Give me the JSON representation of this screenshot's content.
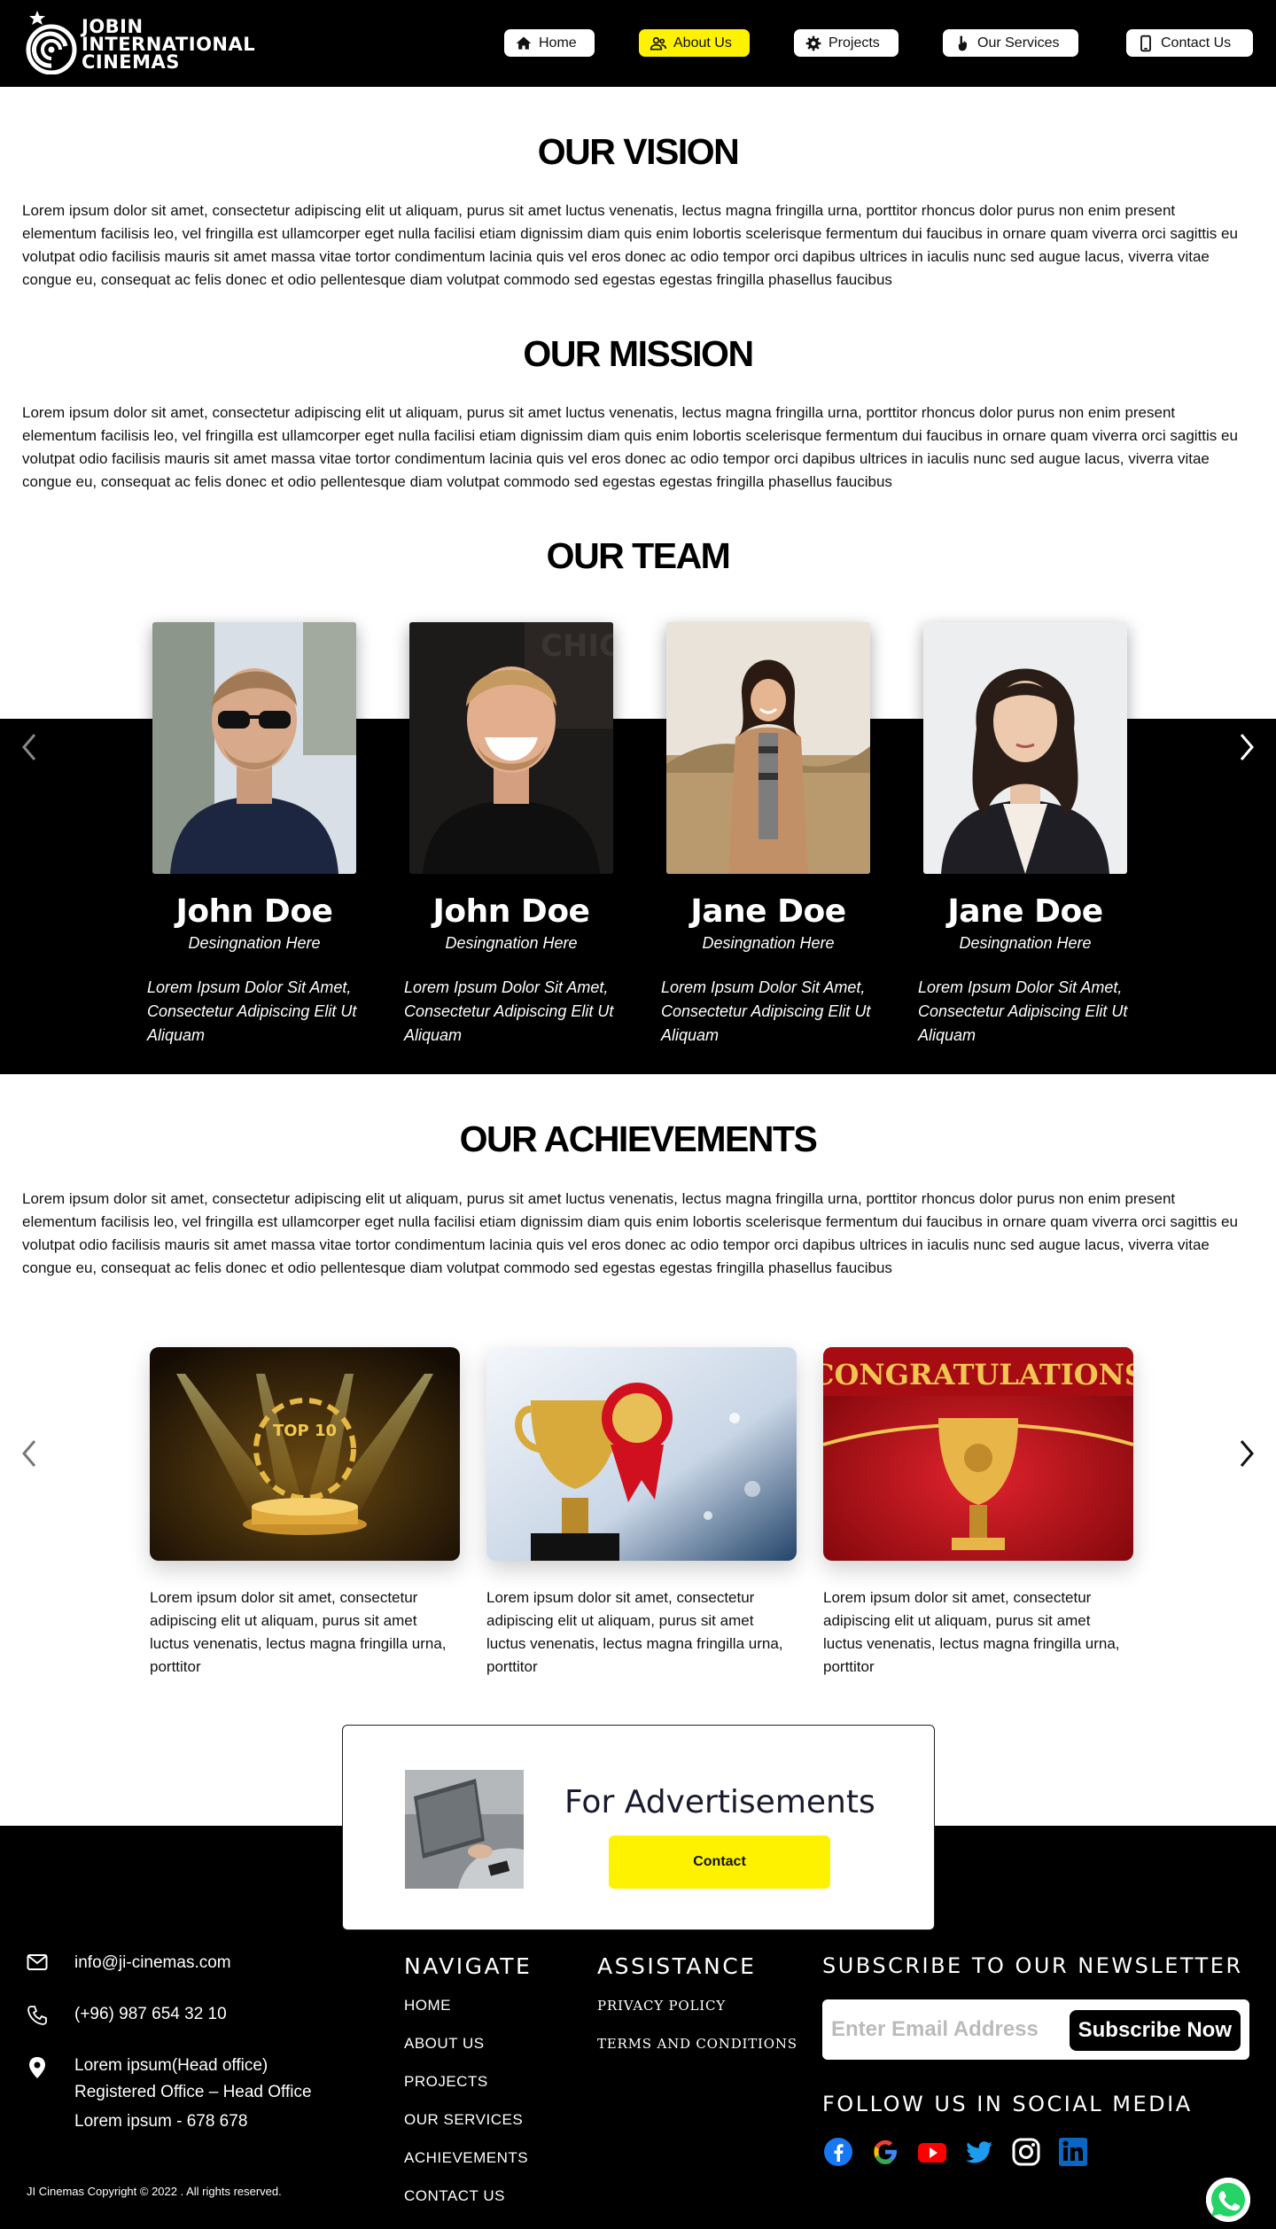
{
  "brand": {
    "line1": "JOBIN",
    "line2": "INTERNATIONAL",
    "line3": "CINEMAS"
  },
  "nav": [
    {
      "label": "Home",
      "icon": "home-icon"
    },
    {
      "label": "About Us",
      "icon": "users-icon",
      "active": true
    },
    {
      "label": "Projects",
      "icon": "gear-icon"
    },
    {
      "label": "Our Services",
      "icon": "hand-pointer-icon"
    },
    {
      "label": "Contact Us",
      "icon": "mobile-phone-icon"
    }
  ],
  "vision": {
    "title": "OUR VISION",
    "text": "Lorem ipsum dolor sit amet, consectetur adipiscing elit ut aliquam, purus sit amet luctus venenatis, lectus magna fringilla urna, porttitor rhoncus dolor purus non enim present elementum facilisis leo, vel fringilla est ullamcorper eget nulla facilisi etiam dignissim diam quis enim lobortis scelerisque fermentum dui faucibus in ornare quam viverra orci sagittis eu volutpat odio facilisis mauris sit amet massa vitae tortor condimentum lacinia quis vel eros donec ac odio tempor orci dapibus ultrices in iaculis nunc sed augue lacus, viverra vitae congue eu, consequat ac felis donec et odio pellentesque diam volutpat commodo sed egestas egestas fringilla phasellus faucibus"
  },
  "mission": {
    "title": "OUR MISSION",
    "text": "Lorem ipsum dolor sit amet, consectetur adipiscing elit ut aliquam, purus sit amet luctus venenatis, lectus magna fringilla urna, porttitor rhoncus dolor purus non enim present elementum facilisis leo, vel fringilla est ullamcorper eget nulla facilisi etiam dignissim diam quis enim lobortis scelerisque fermentum dui faucibus in ornare quam viverra orci sagittis eu volutpat odio facilisis mauris sit amet massa vitae tortor condimentum lacinia quis vel eros donec ac odio tempor orci dapibus ultrices in iaculis nunc sed augue lacus, viverra vitae congue eu, consequat ac felis donec et odio pellentesque diam volutpat commodo sed egestas egestas fringilla phasellus faucibus"
  },
  "team": {
    "title": "OUR TEAM",
    "members": [
      {
        "name": "John Doe",
        "role": "Desingnation Here",
        "bio": "Lorem Ipsum Dolor Sit Amet, Consectetur Adipiscing Elit Ut Aliquam"
      },
      {
        "name": "John Doe",
        "role": "Desingnation Here",
        "bio": "Lorem Ipsum Dolor Sit Amet, Consectetur Adipiscing Elit Ut Aliquam"
      },
      {
        "name": "Jane Doe",
        "role": "Desingnation Here",
        "bio": "Lorem Ipsum Dolor Sit Amet, Consectetur Adipiscing Elit Ut Aliquam"
      },
      {
        "name": "Jane Doe",
        "role": "Desingnation Here",
        "bio": "Lorem Ipsum Dolor Sit Amet, Consectetur Adipiscing Elit Ut Aliquam"
      }
    ]
  },
  "achievements": {
    "title": "OUR ACHIEVEMENTS",
    "text": "Lorem ipsum dolor sit amet, consectetur adipiscing elit ut aliquam, purus sit amet luctus venenatis, lectus magna fringilla urna, porttitor rhoncus dolor purus non enim present elementum facilisis leo, vel fringilla est ullamcorper eget nulla facilisi etiam dignissim diam quis enim lobortis scelerisque fermentum dui faucibus in ornare quam viverra orci sagittis eu volutpat odio facilisis mauris sit amet massa vitae tortor condimentum lacinia quis vel eros donec ac odio tempor orci dapibus ultrices in iaculis nunc sed augue lacus, viverra vitae congue eu, consequat ac felis donec et odio pellentesque diam volutpat commodo sed egestas egestas fringilla phasellus faucibus",
    "cards": [
      {
        "badge": "TOP 10",
        "text": "Lorem ipsum dolor sit amet, consectetur adipiscing elit ut aliquam, purus sit amet luctus venenatis, lectus magna fringilla urna, porttitor"
      },
      {
        "text": "Lorem ipsum dolor sit amet, consectetur adipiscing elit ut aliquam, purus sit amet luctus venenatis, lectus magna fringilla urna, porttitor"
      },
      {
        "badge": "CONGRATULATIONS",
        "text": "Lorem ipsum dolor sit amet, consectetur adipiscing elit ut aliquam, purus sit amet luctus venenatis, lectus magna fringilla urna, porttitor"
      }
    ]
  },
  "advert": {
    "title": "For Advertisements",
    "button": "Contact"
  },
  "footer": {
    "email": "info@ji-cinemas.com",
    "phone": "(+96) 987 654 32 10",
    "address": [
      "Lorem ipsum(Head office)",
      "Registered Office – Head Office",
      "Lorem ipsum - 678 678"
    ],
    "navigate_title": "NAVIGATE",
    "navigate": [
      "HOME",
      "ABOUT US",
      "PROJECTS",
      "OUR SERVICES",
      "ACHIEVEMENTS",
      "CONTACT US"
    ],
    "assistance_title": "ASSISTANCE",
    "assistance": [
      "PRIVACY POLICY",
      "TERMS AND CONDITIONS"
    ],
    "newsletter_title": "SUBSCRIBE TO OUR NEWSLETTER",
    "newsletter_placeholder": "Enter Email Address",
    "newsletter_button": "Subscribe Now",
    "social_title": "FOLLOW US IN SOCIAL MEDIA",
    "social": [
      "facebook-icon",
      "google-icon",
      "youtube-icon",
      "twitter-icon",
      "instagram-icon",
      "linkedin-icon"
    ],
    "copyright": "JI Cinemas Copyright © 2022 . All rights reserved."
  },
  "colors": {
    "accent": "#fff200",
    "dark": "#000000",
    "title_ad": "#1a1a2e"
  }
}
